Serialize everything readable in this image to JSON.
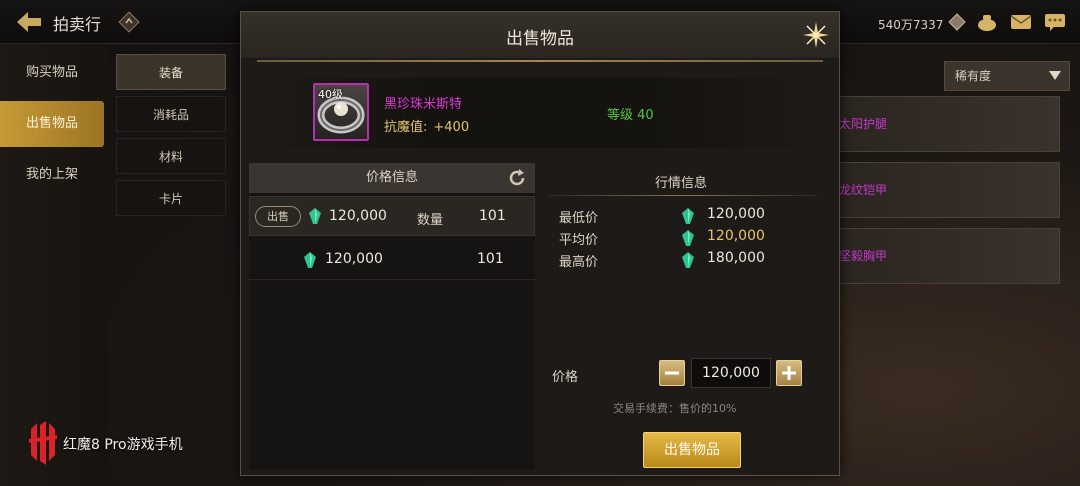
{
  "header": {
    "title": "拍卖行",
    "currency_value": "540万7337",
    "icons": [
      "back-arrow-icon",
      "auction-badge-icon",
      "gem-currency-icon",
      "bag-icon",
      "mail-icon",
      "chat-icon"
    ]
  },
  "sidebar": {
    "items": [
      {
        "label": "购买物品",
        "active": false
      },
      {
        "label": "出售物品",
        "active": true
      },
      {
        "label": "我的上架",
        "active": false
      }
    ]
  },
  "subtabs": [
    {
      "label": "装备",
      "active": true
    },
    {
      "label": "消耗品",
      "active": false
    },
    {
      "label": "材料",
      "active": false
    },
    {
      "label": "卡片",
      "active": false
    }
  ],
  "sort": {
    "selected": "稀有度"
  },
  "background_rows": [
    "太阳护腿",
    "龙纹铠甲",
    "坚毅胸甲"
  ],
  "modal": {
    "title": "出售物品",
    "item": {
      "level_badge": "40级",
      "name": "黑珍珠米斯特",
      "stat_label": "抗魔值:",
      "stat_value": "+400",
      "grade": "等级 40"
    },
    "price_info": {
      "header": "价格信息",
      "selected_row": {
        "tag": "出售",
        "price": "120,000",
        "qty_label": "数量",
        "qty": "101"
      },
      "rows": [
        {
          "price": "120,000",
          "qty": "101"
        }
      ]
    },
    "market_info": {
      "header": "行情信息",
      "rows": [
        {
          "label": "最低价",
          "value": "120,000"
        },
        {
          "label": "平均价",
          "value": "120,000"
        },
        {
          "label": "最高价",
          "value": "180,000"
        }
      ]
    },
    "price_entry": {
      "label": "价格",
      "value": "120,000",
      "minus": "−",
      "plus": "+"
    },
    "fee_note": "交易手续费：售价的10%",
    "sell_button": "出售物品"
  },
  "watermark": {
    "text": "红魔8 Pro游戏手机"
  },
  "colors": {
    "accent_gold": "#c79a35",
    "item_name": "#d93ad3",
    "grade_green": "#58c442",
    "avg_gold": "#e6c36a",
    "gem": "#2fc48f"
  }
}
